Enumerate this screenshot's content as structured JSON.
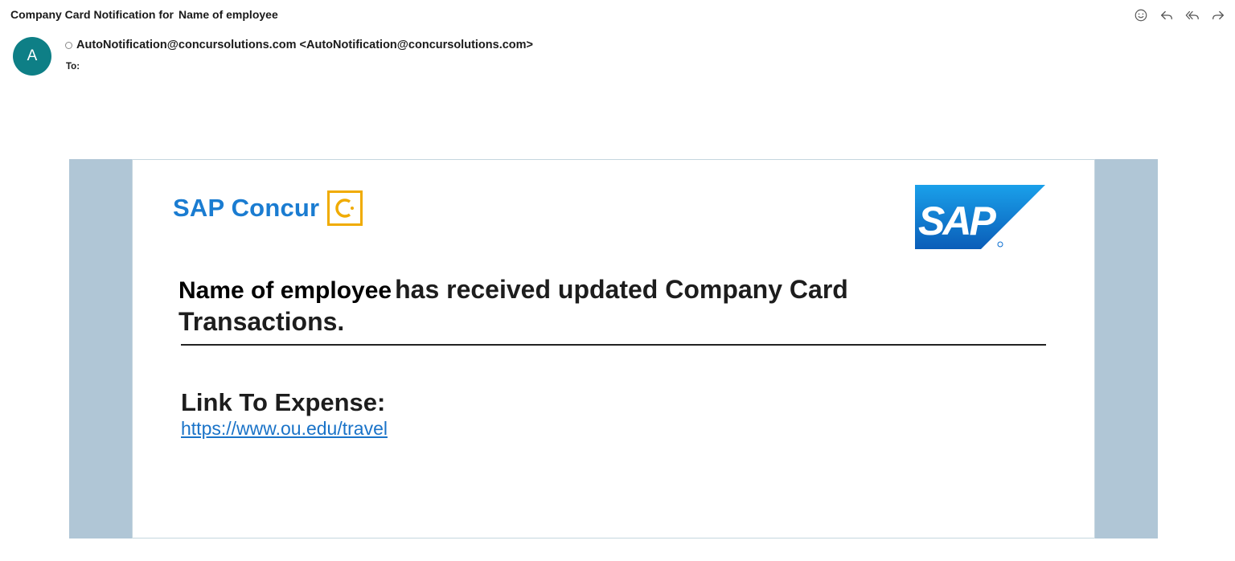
{
  "header": {
    "subject": "Company Card Notification for",
    "subject_placeholder": "Name of employee"
  },
  "actions": [
    {
      "name": "emoji-react-icon"
    },
    {
      "name": "reply-icon"
    },
    {
      "name": "reply-all-icon"
    },
    {
      "name": "forward-icon"
    }
  ],
  "sender": {
    "avatar_initial": "A",
    "avatar_color": "#0e7f86",
    "from": "AutoNotification@concursolutions.com <AutoNotification@concursolutions.com>",
    "to_label": "To:"
  },
  "email": {
    "brand_name": "SAP Concur",
    "brand_color": "#1a7cd1",
    "brand_mark_color": "#f0ab00",
    "sap_logo_text": "SAP",
    "sap_logo_color": "#0a6ed1",
    "headline_name": "Name of employee",
    "headline_rest": "has received updated Company Card Transactions.",
    "link_title": "Link To Expense:",
    "link_url": "https://www.ou.edu/travel",
    "frame_color": "#b0c6d6"
  }
}
